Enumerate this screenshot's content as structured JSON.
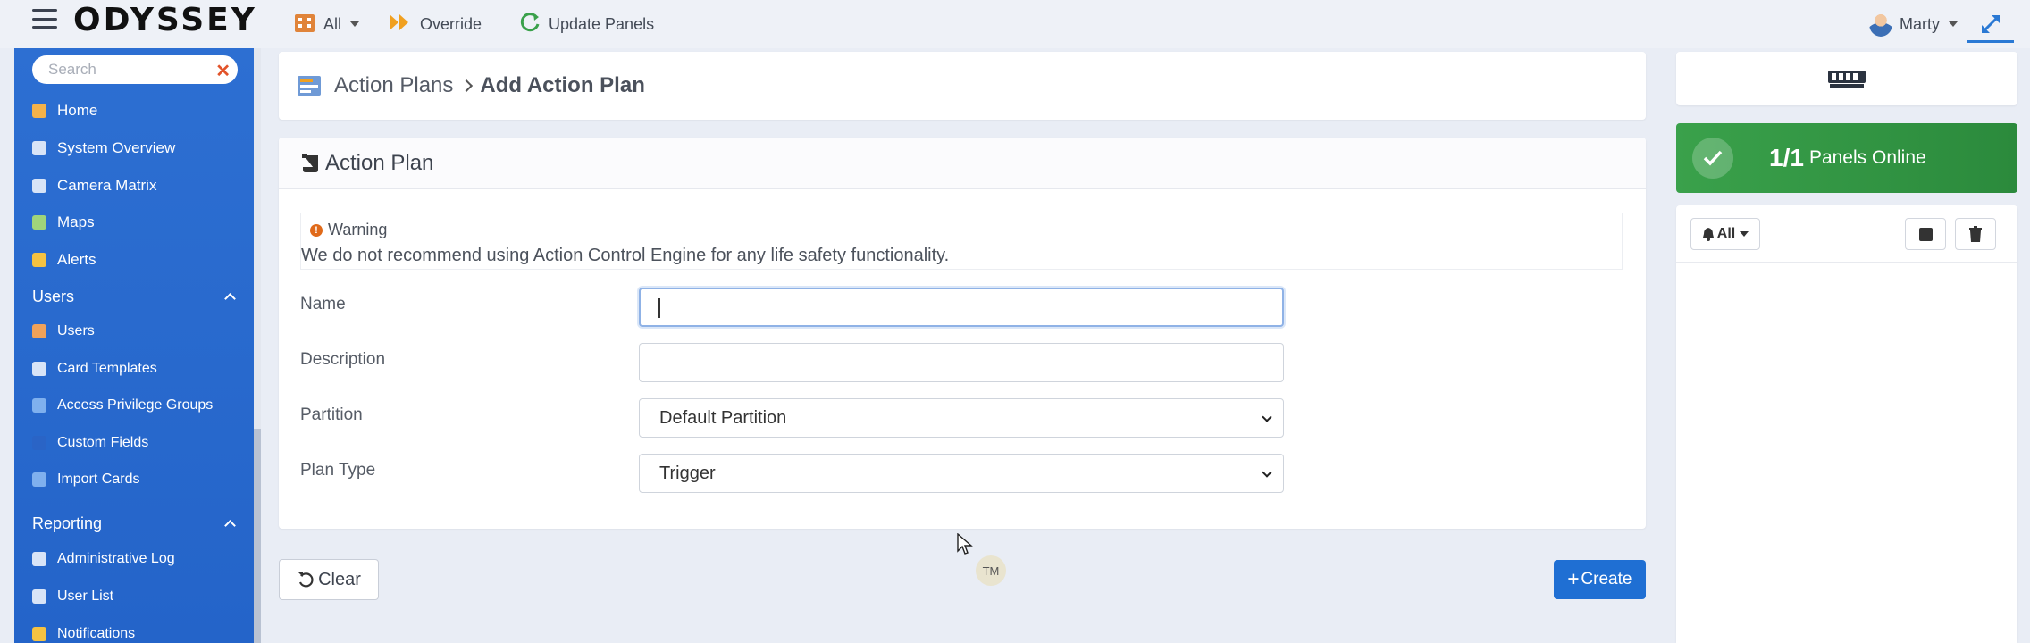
{
  "app": {
    "logo": "ODYSSEY"
  },
  "topbar": {
    "filter_label": "All",
    "override_label": "Override",
    "update_panels_label": "Update Panels",
    "user_name": "Marty"
  },
  "sidebar": {
    "search_placeholder": "Search",
    "items": [
      {
        "label": "Home",
        "icon": "home-icon",
        "color": "#f4b24a"
      },
      {
        "label": "System Overview",
        "icon": "system-overview-icon",
        "color": "#d8e4f7"
      },
      {
        "label": "Camera Matrix",
        "icon": "camera-icon",
        "color": "#d8e4f7"
      },
      {
        "label": "Maps",
        "icon": "map-icon",
        "color": "#9fd47a"
      },
      {
        "label": "Alerts",
        "icon": "bell-icon",
        "color": "#f5c242"
      }
    ],
    "users_section": {
      "label": "Users",
      "items": [
        {
          "label": "Users",
          "icon": "users-icon",
          "color": "#f0a25a"
        },
        {
          "label": "Card Templates",
          "icon": "card-icon",
          "color": "#d8e4f7"
        },
        {
          "label": "Access Privilege Groups",
          "icon": "privilege-icon",
          "color": "#7fb0ee"
        },
        {
          "label": "Custom Fields",
          "icon": "custom-fields-icon",
          "color": "#2a64c6"
        },
        {
          "label": "Import Cards",
          "icon": "import-icon",
          "color": "#7fb0ee"
        }
      ]
    },
    "reporting_section": {
      "label": "Reporting",
      "items": [
        {
          "label": "Administrative Log",
          "icon": "log-icon",
          "color": "#d8e4f7"
        },
        {
          "label": "User List",
          "icon": "list-icon",
          "color": "#d8e4f7"
        },
        {
          "label": "Notifications",
          "icon": "notification-icon",
          "color": "#f5c242"
        }
      ]
    }
  },
  "breadcrumb": {
    "parent": "Action Plans",
    "current": "Add Action Plan"
  },
  "form": {
    "title": "Action Plan",
    "warning_title": "Warning",
    "warning_text": "We do not recommend using Action Control Engine for any life safety functionality.",
    "name_label": "Name",
    "name_value": "",
    "description_label": "Description",
    "description_value": "",
    "partition_label": "Partition",
    "partition_value": "Default Partition",
    "plan_type_label": "Plan Type",
    "plan_type_value": "Trigger"
  },
  "actions": {
    "clear_label": "Clear",
    "create_label": "Create"
  },
  "tm_badge": "TM",
  "panels": {
    "online_count": "1/1",
    "online_label": "Panels Online"
  },
  "alerts": {
    "filter_label": "All"
  },
  "colors": {
    "sidebar_bg": "#2a6bd0",
    "primary": "#1f6fd3",
    "success": "#35984a",
    "warning": "#e06a1a"
  }
}
